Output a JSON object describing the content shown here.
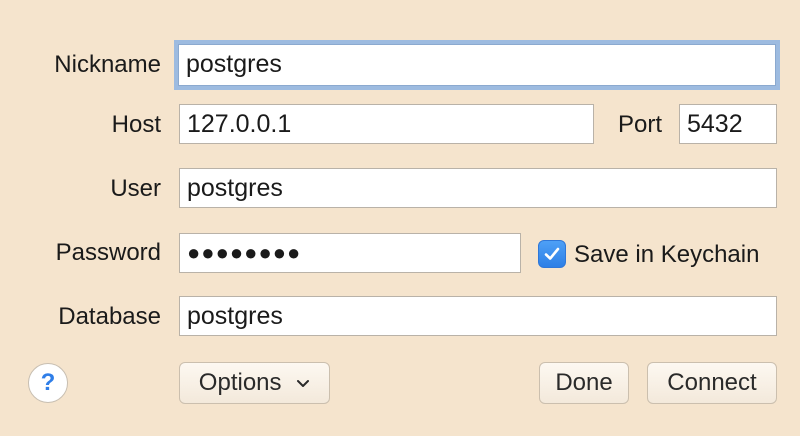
{
  "form": {
    "nickname_label": "Nickname",
    "nickname_value": "postgres",
    "host_label": "Host",
    "host_value": "127.0.0.1",
    "port_label": "Port",
    "port_value": "5432",
    "user_label": "User",
    "user_value": "postgres",
    "password_label": "Password",
    "password_value": "●●●●●●●●",
    "save_keychain_label": "Save in Keychain",
    "save_keychain_checked": true,
    "database_label": "Database",
    "database_value": "postgres"
  },
  "buttons": {
    "help": "?",
    "options": "Options",
    "done": "Done",
    "connect": "Connect"
  },
  "colors": {
    "background": "#f5e4cd",
    "focus_ring": "#9dbbe0",
    "checkbox_blue": "#2d7fe6"
  }
}
